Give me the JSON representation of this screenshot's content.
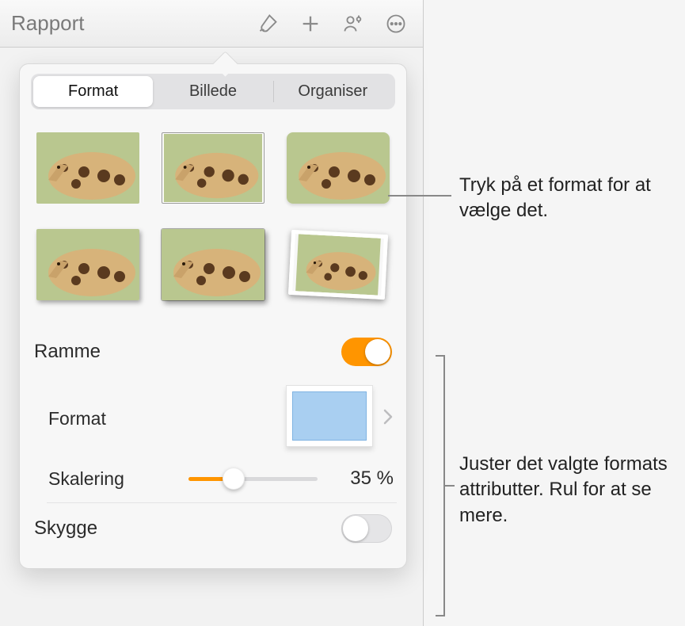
{
  "toolbar": {
    "title": "Rapport"
  },
  "popover": {
    "tabs": {
      "format": "Format",
      "billede": "Billede",
      "organiser": "Organiser"
    },
    "ramme": {
      "label": "Ramme",
      "toggle_on": true,
      "format_label": "Format",
      "skalering_label": "Skalering",
      "skalering_value": "35 %",
      "skalering_percent": 35
    },
    "skygge": {
      "label": "Skygge",
      "toggle_on": false
    }
  },
  "annotations": {
    "tap_style": "Tryk på et format for at vælge det.",
    "adjust_attrs": "Juster det valgte formats attributter. Rul for at se mere."
  },
  "icons": {
    "brush": "brush-icon",
    "plus": "plus-icon",
    "collab": "collab-icon",
    "more": "more-icon",
    "chevron": "chevron-right-icon"
  },
  "colors": {
    "accent": "#ff9500",
    "preview_fill": "#a9cff1"
  }
}
